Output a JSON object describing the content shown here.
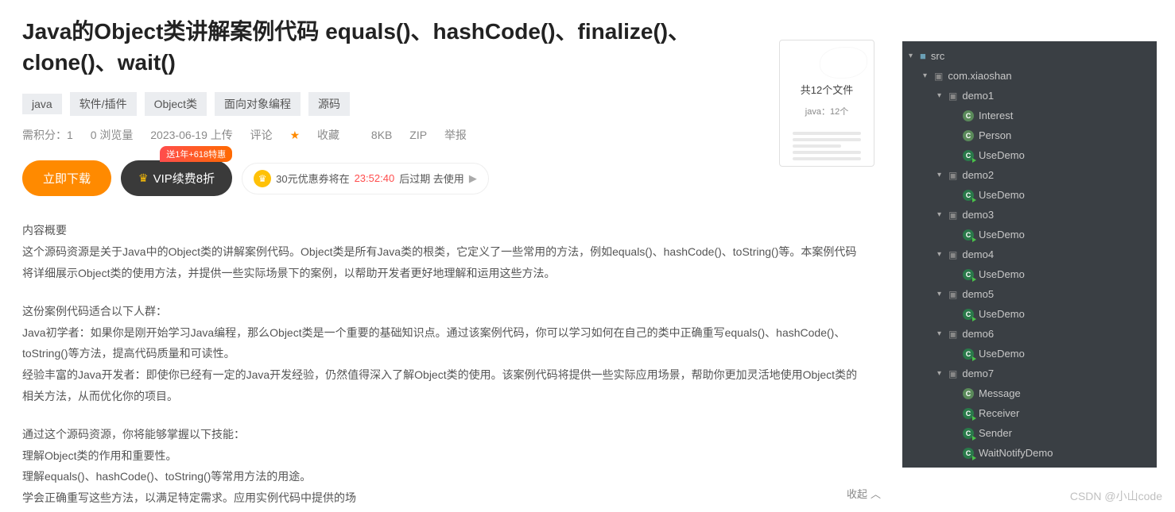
{
  "title": "Java的Object类讲解案例代码 equals()、hashCode()、finalize()、clone()、wait()",
  "tags": [
    "java",
    "软件/插件",
    "Object类",
    "面向对象编程",
    "源码"
  ],
  "meta": {
    "points": "需积分：1",
    "views": "0 浏览量",
    "date": "2023-06-19 上传",
    "comment": "评论",
    "fav": "收藏",
    "size": "8KB",
    "format": "ZIP",
    "report": "举报"
  },
  "actions": {
    "download": "立即下载",
    "vip": "VIP续费8折",
    "promo": "送1年+618特惠",
    "coupon_prefix": "30元优惠券将在",
    "coupon_time": "23:52:40",
    "coupon_suffix": "后过期 去使用"
  },
  "file_preview": {
    "count": "共12个文件",
    "sub": "java：12个"
  },
  "content": {
    "h1": "内容概要",
    "p1": "这个源码资源是关于Java中的Object类的讲解案例代码。Object类是所有Java类的根类，它定义了一些常用的方法，例如equals()、hashCode()、toString()等。本案例代码将详细展示Object类的使用方法，并提供一些实际场景下的案例，以帮助开发者更好地理解和运用这些方法。",
    "h2": "这份案例代码适合以下人群：",
    "p2a": "Java初学者：如果你是刚开始学习Java编程，那么Object类是一个重要的基础知识点。通过该案例代码，你可以学习如何在自己的类中正确重写equals()、hashCode()、toString()等方法，提高代码质量和可读性。",
    "p2b": "经验丰富的Java开发者：即使你已经有一定的Java开发经验，仍然值得深入了解Object类的使用。该案例代码将提供一些实际应用场景，帮助你更加灵活地使用Object类的相关方法，从而优化你的项目。",
    "h3": "通过这个源码资源，你将能够掌握以下技能：",
    "p3a": "理解Object类的作用和重要性。",
    "p3b": "理解equals()、hashCode()、toString()等常用方法的用途。",
    "p3c": "学会正确重写这些方法，以满足特定需求。应用实例代码中提供的场"
  },
  "collapse": "收起",
  "watermark": "CSDN @小山code",
  "tree": {
    "root": "src",
    "pkg": "com.xiaoshan",
    "nodes": [
      {
        "name": "demo1",
        "children": [
          {
            "name": "Interest",
            "run": false
          },
          {
            "name": "Person",
            "run": false
          },
          {
            "name": "UseDemo",
            "run": true
          }
        ]
      },
      {
        "name": "demo2",
        "children": [
          {
            "name": "UseDemo",
            "run": true
          }
        ]
      },
      {
        "name": "demo3",
        "children": [
          {
            "name": "UseDemo",
            "run": true
          }
        ]
      },
      {
        "name": "demo4",
        "children": [
          {
            "name": "UseDemo",
            "run": true
          }
        ]
      },
      {
        "name": "demo5",
        "children": [
          {
            "name": "UseDemo",
            "run": true
          }
        ]
      },
      {
        "name": "demo6",
        "children": [
          {
            "name": "UseDemo",
            "run": true
          }
        ]
      },
      {
        "name": "demo7",
        "children": [
          {
            "name": "Message",
            "run": false
          },
          {
            "name": "Receiver",
            "run": true
          },
          {
            "name": "Sender",
            "run": true
          },
          {
            "name": "WaitNotifyDemo",
            "run": true
          }
        ]
      }
    ]
  }
}
